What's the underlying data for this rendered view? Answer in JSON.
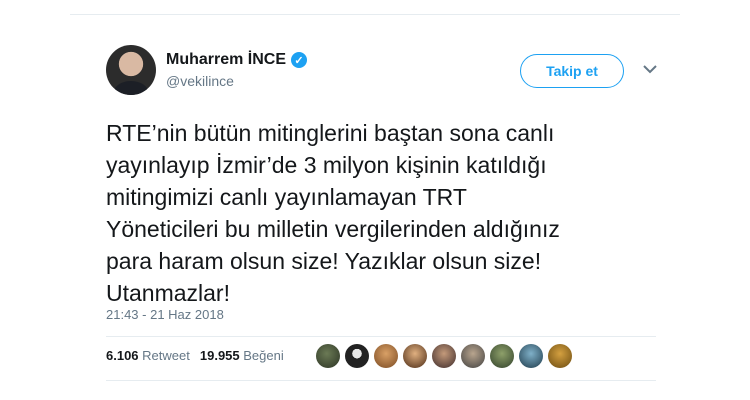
{
  "user": {
    "name": "Muharrem İNCE",
    "handle": "@vekilince",
    "verified_icon": "verified-badge-icon"
  },
  "follow_button_label": "Takip et",
  "menu_icon": "chevron-down-icon",
  "tweet_text": "RTE’nin bütün mitinglerini baştan sona canlı\nyayınlayıp İzmir’de 3 milyon kişinin katıldığı\nmitingimizi canlı yayınlamayan TRT\nYöneticileri bu milletin vergilerinden aldığınız\npara haram olsun size! Yazıklar olsun size!\nUtanmazlar!",
  "timestamp": "21:43 - 21 Haz 2018",
  "stats": {
    "retweet_count": "6.106",
    "retweet_label": "Retweet",
    "like_count": "19.955",
    "like_label": "Beğeni"
  },
  "colors": {
    "accent": "#1da1f2",
    "secondary_text": "#657786",
    "divider": "#e6ecf0"
  }
}
